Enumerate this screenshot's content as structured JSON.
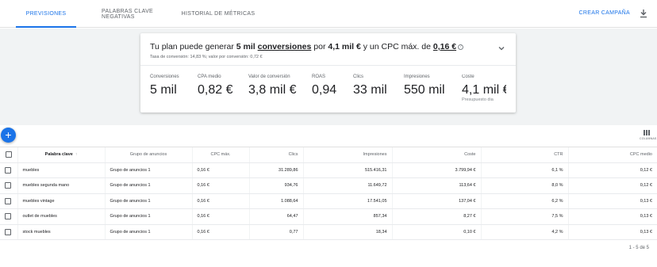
{
  "tabs": [
    {
      "label": "PREVISIONES",
      "active": true
    },
    {
      "label": "PALABRAS CLAVE NEGATIVAS",
      "active": false
    },
    {
      "label": "HISTORIAL DE MÉTRICAS",
      "active": false
    }
  ],
  "create_campaign": "CREAR CAMPAÑA",
  "summary": {
    "headline_pre": "Tu plan puede generar ",
    "headline_conv": "5 mil",
    "headline_conv_word": "conversiones",
    "headline_mid": " por ",
    "headline_cost": "4,1 mil €",
    "headline_mid2": " y un CPC máx. de ",
    "headline_cpc": "0,16 €",
    "subline": "Tasa de conversión: 14,83 %; valor por conversión: 0,72 €"
  },
  "metrics": [
    {
      "label": "Conversiones",
      "value": "5 mil"
    },
    {
      "label": "CPA medio",
      "value": "0,82 €"
    },
    {
      "label": "Valor de conversión",
      "value": "3,8 mil €"
    },
    {
      "label": "ROAS",
      "value": "0,94"
    },
    {
      "label": "Clics",
      "value": "33 mil"
    },
    {
      "label": "Impresiones",
      "value": "550 mil"
    },
    {
      "label": "Coste",
      "value": "4,1 mil €"
    }
  ],
  "budget_note": "Presupuesto dia",
  "columns_caption": "COLUMNAS",
  "table": {
    "headers": [
      "Palabra clave",
      "Grupo de anuncios",
      "CPC máx.",
      "Clics",
      "Impresiones",
      "Coste",
      "CTR",
      "CPC medio"
    ],
    "rows": [
      [
        "muebles",
        "Grupo de anuncios 1",
        "0,16 €",
        "31.289,86",
        "515.416,31",
        "3.799,94 €",
        "6,1 %",
        "0,12 €"
      ],
      [
        "muebles segunda mano",
        "Grupo de anuncios 1",
        "0,16 €",
        "934,76",
        "11.649,72",
        "113,64 €",
        "8,0 %",
        "0,12 €"
      ],
      [
        "muebles vintage",
        "Grupo de anuncios 1",
        "0,16 €",
        "1.088,64",
        "17.541,05",
        "137,04 €",
        "6,2 %",
        "0,13 €"
      ],
      [
        "outlet de muebles",
        "Grupo de anuncios 1",
        "0,16 €",
        "64,47",
        "857,34",
        "8,27 €",
        "7,5 %",
        "0,13 €"
      ],
      [
        "stock muebles",
        "Grupo de anuncios 1",
        "0,16 €",
        "0,77",
        "18,34",
        "0,10 €",
        "4,2 %",
        "0,13 €"
      ]
    ]
  },
  "pagination": "1 - 5 de 5",
  "colors": {
    "accent": "#1a73e8",
    "background_gray": "#f1f3f4"
  }
}
